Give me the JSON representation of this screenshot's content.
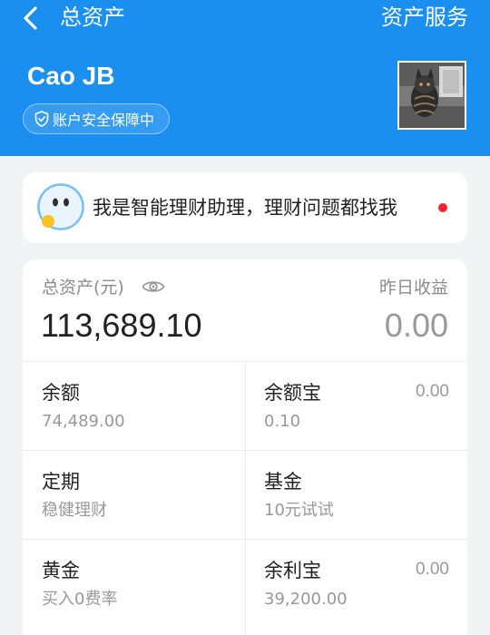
{
  "header": {
    "title": "总资产",
    "service_label": "资产服务",
    "username": "Cao JB",
    "security_badge": "账户安全保障中"
  },
  "assistant": {
    "text": "我是智能理财助理，理财问题都找我"
  },
  "assets": {
    "total_label": "总资产(元)",
    "total_value": "113,689.10",
    "yesterday_label": "昨日收益",
    "yesterday_value": "0.00",
    "items": [
      {
        "name": "余额",
        "sub": "74,489.00",
        "right": ""
      },
      {
        "name": "余额宝",
        "sub": "0.10",
        "right": "0.00"
      },
      {
        "name": "定期",
        "sub": "稳健理财",
        "right": ""
      },
      {
        "name": "基金",
        "sub": "10元试试",
        "right": ""
      },
      {
        "name": "黄金",
        "sub": "买入0费率",
        "right": ""
      },
      {
        "name": "余利宝",
        "sub": "39,200.00",
        "right": "0.00"
      }
    ]
  },
  "colors": {
    "brand_blue": "#1b8ff0",
    "notification_red": "#f5222d",
    "page_background": "#f2f3f5"
  },
  "icons": [
    "back-arrow-icon",
    "shield-icon",
    "eye-icon",
    "assistant-bot-icon"
  ]
}
